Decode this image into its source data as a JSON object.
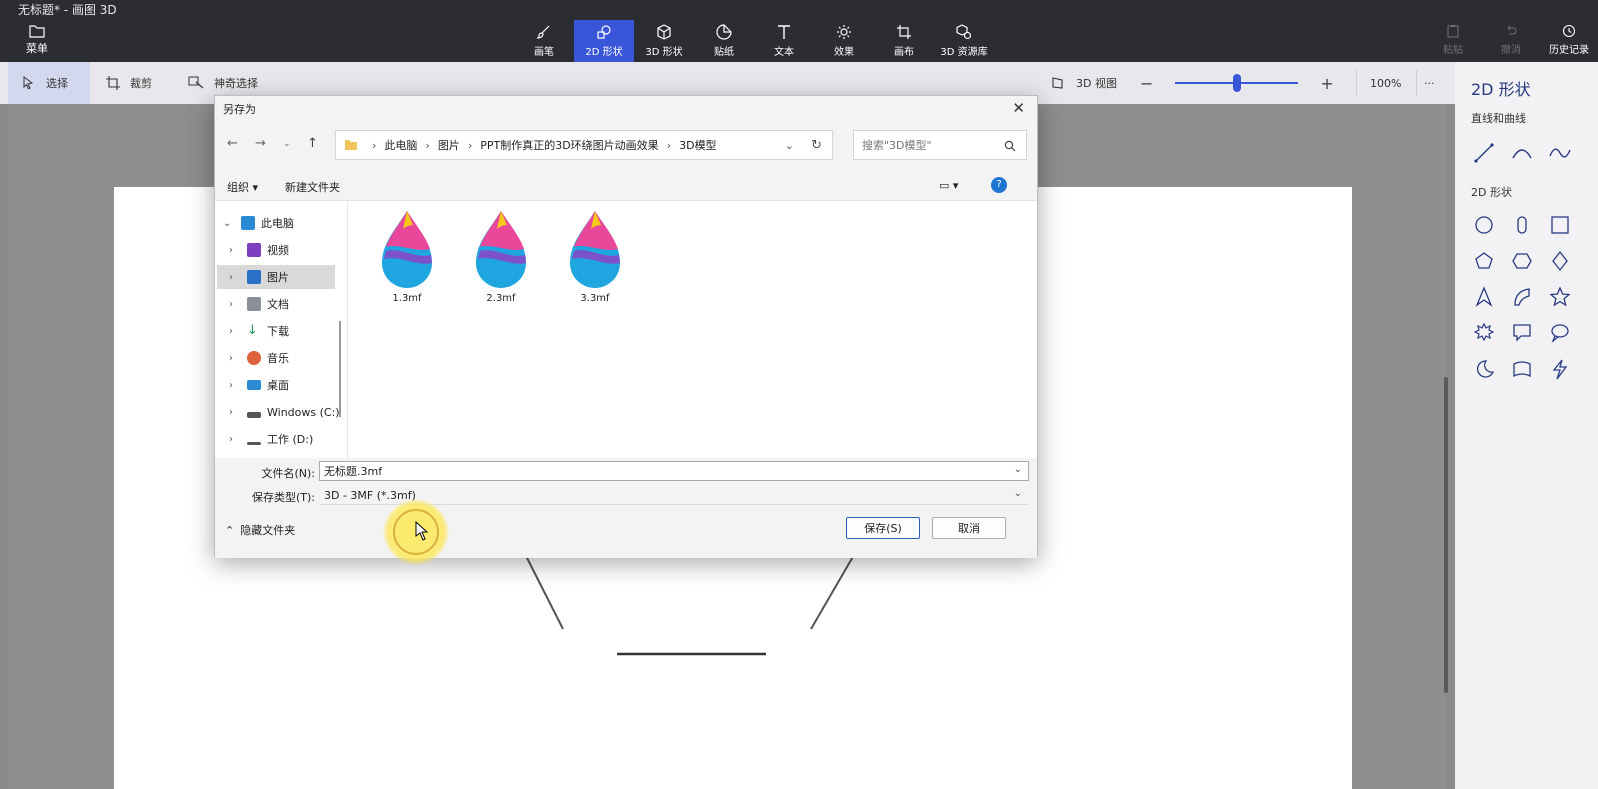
{
  "app": {
    "title": "无标题* - 画图 3D",
    "menu_label": "菜单"
  },
  "tools": [
    {
      "label": "画笔",
      "icon": "brush-icon"
    },
    {
      "label": "2D 形状",
      "icon": "2d-shapes-icon",
      "active": true
    },
    {
      "label": "3D 形状",
      "icon": "3d-shapes-icon"
    },
    {
      "label": "贴纸",
      "icon": "sticker-icon"
    },
    {
      "label": "文本",
      "icon": "text-icon"
    },
    {
      "label": "效果",
      "icon": "effects-icon"
    },
    {
      "label": "画布",
      "icon": "canvas-icon"
    },
    {
      "label": "3D 资源库",
      "icon": "3d-library-icon"
    }
  ],
  "actions": {
    "paste": "粘贴",
    "undo": "撤消",
    "history": "历史记录"
  },
  "subbar": {
    "select": "选择",
    "crop": "裁剪",
    "magic_select": "神奇选择",
    "view3d": "3D 视图",
    "zoom_percent": "100%",
    "more": "···",
    "zoom_level": 0.5
  },
  "panel": {
    "title": "2D 形状",
    "lines_heading": "直线和曲线",
    "shapes_heading": "2D 形状"
  },
  "dialog": {
    "title": "另存为",
    "breadcrumb": [
      "此电脑",
      "图片",
      "PPT制作真正的3D环绕图片动画效果",
      "3D模型"
    ],
    "search_placeholder": "搜索\"3D模型\"",
    "organize": "组织 ▾",
    "new_folder": "新建文件夹",
    "tree": [
      {
        "label": "此电脑",
        "expanded": true
      },
      {
        "label": "视频"
      },
      {
        "label": "图片",
        "selected": true
      },
      {
        "label": "文档"
      },
      {
        "label": "下载"
      },
      {
        "label": "音乐"
      },
      {
        "label": "桌面"
      },
      {
        "label": "Windows (C:)"
      },
      {
        "label": "工作 (D:)"
      }
    ],
    "files": [
      "1.3mf",
      "2.3mf",
      "3.3mf"
    ],
    "filename_label": "文件名(N):",
    "filename_value": "无标题.3mf",
    "filetype_label": "保存类型(T):",
    "filetype_value": "3D - 3MF (*.3mf)",
    "hide_folders": "隐藏文件夹",
    "save": "保存(S)",
    "cancel": "取消"
  }
}
